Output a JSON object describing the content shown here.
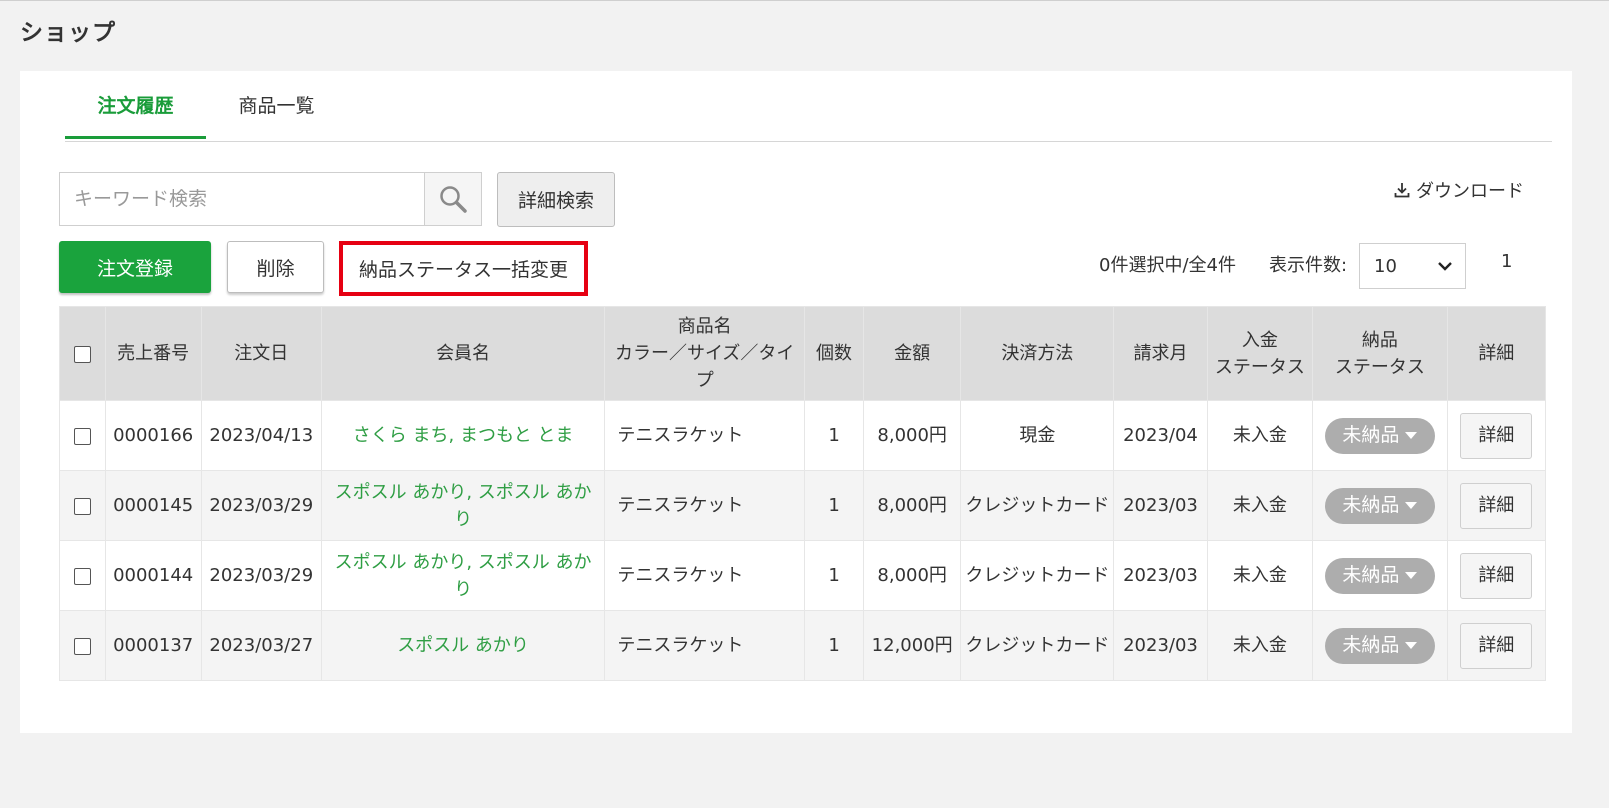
{
  "page": {
    "title": "ショップ"
  },
  "tabs": [
    {
      "label": "注文履歴",
      "active": true
    },
    {
      "label": "商品一覧",
      "active": false
    }
  ],
  "search": {
    "placeholder": "キーワード検索",
    "value": "",
    "advanced_label": "詳細検索"
  },
  "toolbar": {
    "download_label": "ダウンロード",
    "register_label": "注文登録",
    "delete_label": "削除",
    "bulk_change_label": "納品ステータス一括変更",
    "selection_info": "0件選択中/全4件",
    "per_page_label": "表示件数:",
    "per_page_value": "10",
    "current_page": "1"
  },
  "table": {
    "headers": {
      "sales_no": "売上番号",
      "order_date": "注文日",
      "member": "会員名",
      "product_line1": "商品名",
      "product_line2": "カラー／サイズ／タイプ",
      "qty": "個数",
      "amount": "金額",
      "payment": "決済方法",
      "billing_month": "請求月",
      "payment_status_line1": "入金",
      "payment_status_line2": "ステータス",
      "delivery_status_line1": "納品",
      "delivery_status_line2": "ステータス",
      "detail": "詳細"
    },
    "rows": [
      {
        "sales_no": "0000166",
        "order_date": "2023/04/13",
        "member": "さくら まち, まつもと とま",
        "product": "テニスラケット",
        "qty": "1",
        "amount": "8,000円",
        "payment": "現金",
        "billing_month": "2023/04",
        "payment_status": "未入金",
        "delivery_status": "未納品",
        "detail": "詳細"
      },
      {
        "sales_no": "0000145",
        "order_date": "2023/03/29",
        "member": "スポスル あかり, スポスル あかり",
        "product": "テニスラケット",
        "qty": "1",
        "amount": "8,000円",
        "payment": "クレジットカード",
        "billing_month": "2023/03",
        "payment_status": "未入金",
        "delivery_status": "未納品",
        "detail": "詳細"
      },
      {
        "sales_no": "0000144",
        "order_date": "2023/03/29",
        "member": "スポスル あかり, スポスル あかり",
        "product": "テニスラケット",
        "qty": "1",
        "amount": "8,000円",
        "payment": "クレジットカード",
        "billing_month": "2023/03",
        "payment_status": "未入金",
        "delivery_status": "未納品",
        "detail": "詳細"
      },
      {
        "sales_no": "0000137",
        "order_date": "2023/03/27",
        "member": "スポスル あかり",
        "product": "テニスラケット",
        "qty": "1",
        "amount": "12,000円",
        "payment": "クレジットカード",
        "billing_month": "2023/03",
        "payment_status": "未入金",
        "delivery_status": "未納品",
        "detail": "詳細"
      }
    ]
  },
  "colors": {
    "accent": "#1aa33d",
    "highlight": "#e60012",
    "link": "#2f9e44",
    "unpaid": "#e60012",
    "pill": "#adadad"
  },
  "icons": {
    "search": "search-icon",
    "download": "download-icon",
    "dropdown": "chevron-down-icon",
    "caret": "caret-down-icon"
  }
}
